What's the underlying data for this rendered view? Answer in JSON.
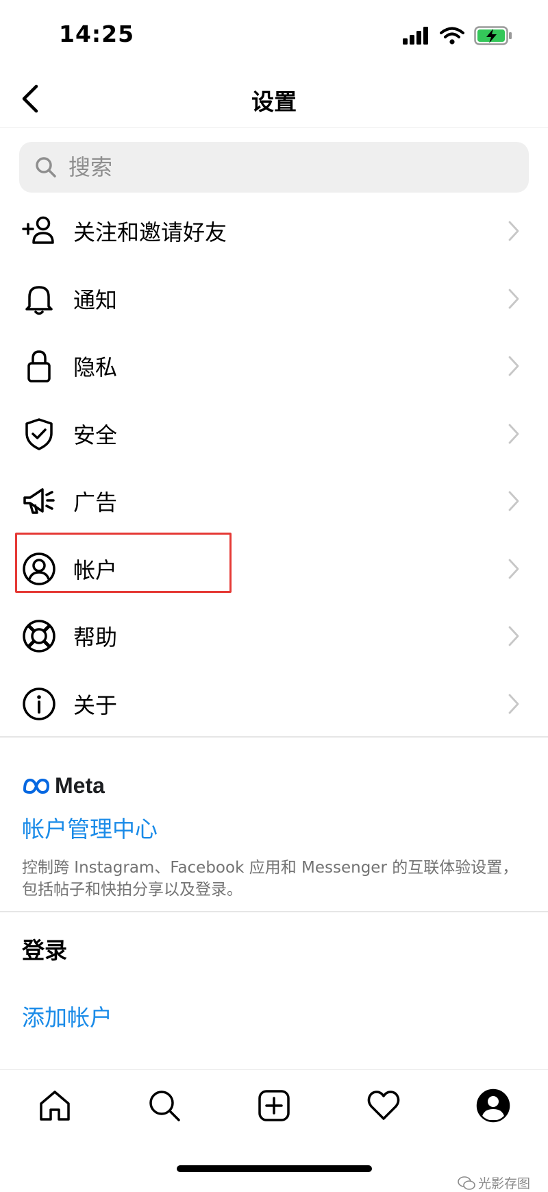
{
  "status_bar": {
    "time": "14:25"
  },
  "nav": {
    "title": "设置"
  },
  "search": {
    "placeholder": "搜索"
  },
  "menu_items": [
    {
      "label": "关注和邀请好友",
      "icon": "add-person-icon"
    },
    {
      "label": "通知",
      "icon": "bell-icon"
    },
    {
      "label": "隐私",
      "icon": "lock-icon"
    },
    {
      "label": "安全",
      "icon": "shield-check-icon"
    },
    {
      "label": "广告",
      "icon": "megaphone-icon"
    },
    {
      "label": "帐户",
      "icon": "account-circle-icon"
    },
    {
      "label": "帮助",
      "icon": "lifebuoy-icon"
    },
    {
      "label": "关于",
      "icon": "info-icon"
    }
  ],
  "meta": {
    "logo_text": "Meta",
    "accounts_center_link": "帐户管理中心",
    "description": "控制跨 Instagram、Facebook 应用和 Messenger 的互联体验设置，包括帖子和快拍分享以及登录。"
  },
  "login": {
    "title": "登录",
    "add_account_link": "添加帐户"
  },
  "tab_bar": [
    "home-icon",
    "search-icon",
    "create-post-icon",
    "heart-icon",
    "profile-icon"
  ],
  "watermark": "光影存图",
  "colors": {
    "link": "#1a8be8",
    "highlight": "#e53935",
    "battery": "#34c759"
  }
}
